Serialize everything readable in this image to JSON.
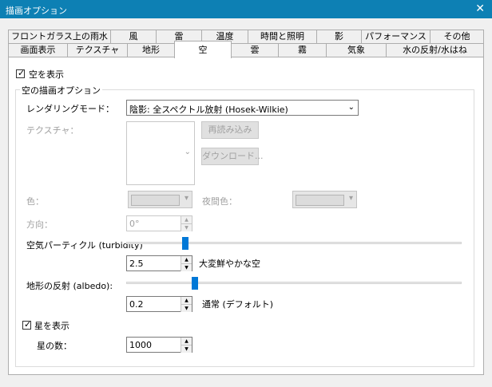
{
  "window": {
    "title": "描画オプション",
    "close_glyph": "✕"
  },
  "tabs_back": [
    "フロントガラス上の雨水",
    "風",
    "雷",
    "温度",
    "時間と照明",
    "影",
    "パフォーマンス",
    "その他"
  ],
  "tabs_front": [
    "画面表示",
    "テクスチャ",
    "地形",
    "空",
    "雲",
    "霧",
    "気象",
    "水の反射/水はね"
  ],
  "active_tab": "空",
  "sky": {
    "show_label": "空を表示",
    "show_checked": true,
    "group_title": "空の描画オプション",
    "rendering_mode_label": "レンダリングモード：",
    "rendering_mode_value": "陰影: 全スペクトル放射 (Hosek-Wilkie)",
    "texture_label": "テクスチャ：",
    "reload_button": "再読み込み",
    "download_button": "ダウンロード...",
    "color_label": "色：",
    "night_color_label": "夜間色：",
    "direction_label": "方向：",
    "direction_value": "0°",
    "turbidity_label": "空気パーティクル (turbidity)",
    "turbidity_value": "2.5",
    "turbidity_fraction": 0.17,
    "turbidity_desc": "大変鮮やかな空",
    "albedo_label": "地形の反射 (albedo):",
    "albedo_value": "0.2",
    "albedo_fraction": 0.2,
    "albedo_desc": "通常 (デフォルト)",
    "stars_label": "星を表示",
    "stars_checked": true,
    "star_count_label": "星の数：",
    "star_count_value": "1000"
  },
  "glyphs": {
    "check": "✓",
    "dropdown": "▾",
    "spin_up": "▲",
    "spin_down": "▼",
    "chevron": "⌄"
  }
}
